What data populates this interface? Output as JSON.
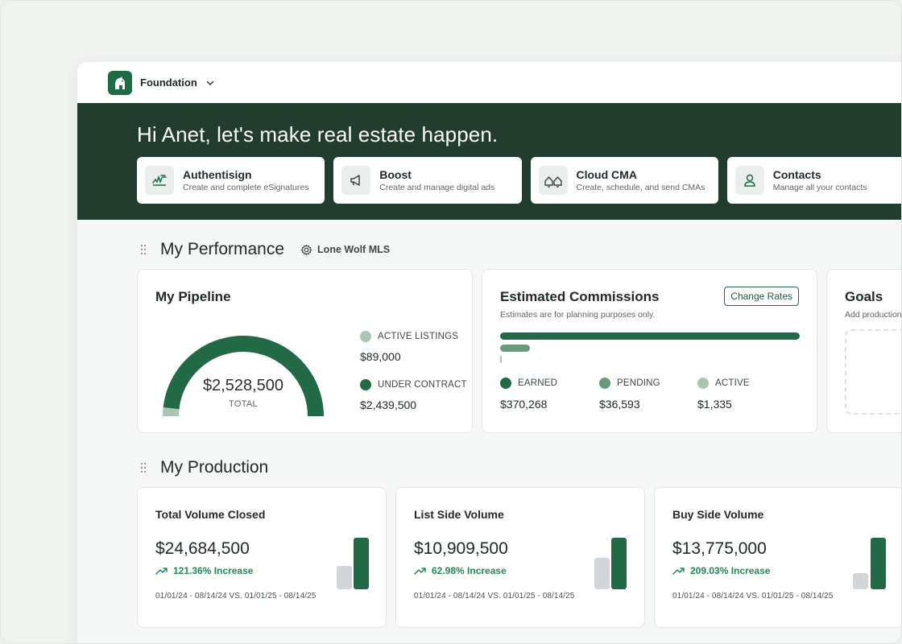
{
  "topbar": {
    "org_name": "Foundation"
  },
  "hero": {
    "greeting": "Hi Anet, let's make real estate happen.",
    "apps": [
      {
        "title": "Authentisign",
        "subtitle": "Create and complete eSignatures",
        "icon": "signature-icon"
      },
      {
        "title": "Boost",
        "subtitle": "Create and manage digital ads",
        "icon": "megaphone-icon"
      },
      {
        "title": "Cloud CMA",
        "subtitle": "Create, schedule, and send CMAs",
        "icon": "houses-icon"
      },
      {
        "title": "Contacts",
        "subtitle": "Manage all your contacts",
        "icon": "person-icon"
      }
    ]
  },
  "performance": {
    "title": "My Performance",
    "mls": "Lone Wolf MLS",
    "pipeline": {
      "title": "My Pipeline",
      "total_value": "$2,528,500",
      "total_label": "TOTAL",
      "active_label": "ACTIVE LISTINGS",
      "active_value": "$89,000",
      "contract_label": "UNDER CONTRACT",
      "contract_value": "$2,439,500",
      "active_fraction": 0.035,
      "colors": {
        "active": "#a9c6b4",
        "contract": "#226a45"
      }
    },
    "commissions": {
      "title": "Estimated Commissions",
      "subtitle": "Estimates are for planning purposes only.",
      "change_rates": "Change Rates",
      "earned_label": "EARNED",
      "earned_value": "$370,268",
      "pending_label": "PENDING",
      "pending_value": "$36,593",
      "active_label": "ACTIVE",
      "active_value": "$1,335",
      "colors": {
        "earned": "#226a45",
        "pending": "#6a9a7d",
        "active": "#a9c6b4"
      }
    },
    "goals": {
      "title": "Goals",
      "subtitle": "Add production"
    }
  },
  "production": {
    "title": "My Production",
    "cards": [
      {
        "title": "Total Volume Closed",
        "value": "$24,684,500",
        "increase": "121.36% Increase",
        "dates": "01/01/24 - 08/14/24 VS. 01/01/25 - 08/14/25",
        "prev_fraction": 0.45,
        "curr_fraction": 1.0
      },
      {
        "title": "List Side Volume",
        "value": "$10,909,500",
        "increase": "62.98% Increase",
        "dates": "01/01/24 - 08/14/24 VS. 01/01/25 - 08/14/25",
        "prev_fraction": 0.61,
        "curr_fraction": 1.0
      },
      {
        "title": "Buy Side Volume",
        "value": "$13,775,000",
        "increase": "209.03% Increase",
        "dates": "01/01/24 - 08/14/24 VS. 01/01/25 - 08/14/25",
        "prev_fraction": 0.32,
        "curr_fraction": 1.0
      }
    ],
    "colors": {
      "prev": "#d3d6d8",
      "curr": "#226a45",
      "increase": "#1f8a55"
    }
  }
}
